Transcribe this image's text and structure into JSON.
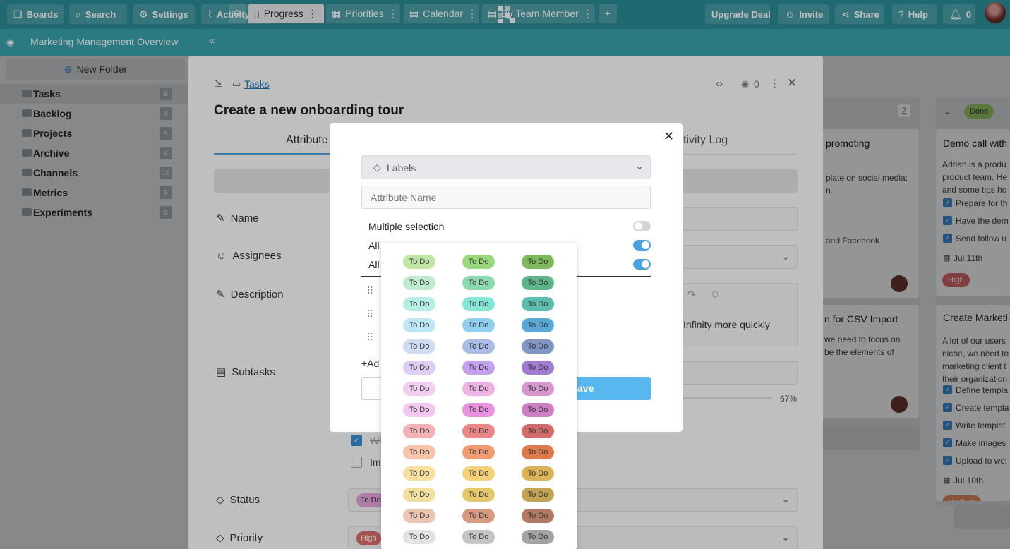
{
  "topbar": {
    "boards": "Boards",
    "search": "Search",
    "settings": "Settings",
    "activity_log": "Activity Log",
    "upgrade": "Upgrade Deal",
    "invite": "Invite",
    "share": "Share",
    "help": "Help",
    "notifications": "0"
  },
  "tabbar": {
    "board_title": "Marketing Management Overview",
    "tabs": [
      {
        "label": "Progress"
      },
      {
        "label": "Priorities"
      },
      {
        "label": "Calendar"
      },
      {
        "label": "By Team Member"
      }
    ],
    "add": "+"
  },
  "sidebar": {
    "new_folder": "New Folder",
    "folders": [
      {
        "label": "Tasks",
        "count": "8"
      },
      {
        "label": "Backlog",
        "count": "4"
      },
      {
        "label": "Projects",
        "count": "8"
      },
      {
        "label": "Archive",
        "count": "4"
      },
      {
        "label": "Channels",
        "count": "16"
      },
      {
        "label": "Metrics",
        "count": "9"
      },
      {
        "label": "Experiments",
        "count": "8"
      }
    ]
  },
  "board": {
    "col_count": "2",
    "done_badge": "Done",
    "cards": [
      {
        "title": "promoting",
        "line1": "plate on social media:",
        "line2": "n.",
        "line3": "and Facebook"
      },
      {
        "title": "n for CSV Import",
        "line1": "we need to focus on",
        "line2": "be the elements of"
      }
    ],
    "right_card1": {
      "title": "Demo call with",
      "body": [
        "Adrian is a produ",
        "product team. He",
        "and some tips ho"
      ],
      "checks": [
        "Prepare for th",
        "Have the dem",
        "Send follow u"
      ],
      "date": "Jul 11th",
      "priority": "High"
    },
    "right_card2": {
      "title": "Create Marketi",
      "body": [
        "A lot of our users",
        "niche, we need to",
        "marketing client t",
        "their organization"
      ],
      "checks": [
        "Define templa",
        "Create templa",
        "Write templat",
        "Make images",
        "Upload to wel"
      ],
      "date": "Jul 10th",
      "priority": "Medium"
    }
  },
  "task": {
    "breadcrumb": "Tasks",
    "watchers": "0",
    "title": "Create a new onboarding tour",
    "tab_attributes": "Attribute",
    "tab_activity": "ctivity Log",
    "labels": {
      "name": "Name",
      "assignees": "Assignees",
      "description": "Description",
      "subtasks": "Subtasks",
      "status": "Status",
      "priority": "Priority"
    },
    "description_text": "Infinity more quickly",
    "progress": "67%",
    "subtask1": "Wr",
    "subtask2": "Im",
    "status_value": "To Do",
    "priority_value": "High"
  },
  "modal": {
    "type_select": "Labels",
    "attr_name_placeholder": "Attribute Name",
    "multiple_selection": "Multiple selection",
    "allow1": "All",
    "allow2": "All",
    "add": "+Ad",
    "save": "ave"
  },
  "palette": {
    "chip_label": "To Do",
    "rows": [
      [
        "#bfe6a4",
        "#99d97b",
        "#7fb95e"
      ],
      [
        "#bfead0",
        "#8fd9ae",
        "#5fb48a"
      ],
      [
        "#b5efe4",
        "#86e6d6",
        "#5cbdb0"
      ],
      [
        "#bfe6f7",
        "#92d0ef",
        "#5aa9d8"
      ],
      [
        "#cfdcf2",
        "#a9bce5",
        "#7f95c4"
      ],
      [
        "#decdf2",
        "#c3a1ec",
        "#a07ccf"
      ],
      [
        "#f3cfee",
        "#eeb3e5",
        "#d697cf"
      ],
      [
        "#f3c8ef",
        "#e993e0",
        "#cc7fc2"
      ],
      [
        "#f3b3b4",
        "#ec8787",
        "#d26b6c"
      ],
      [
        "#f7c3a8",
        "#f29a70",
        "#dc7a4e"
      ],
      [
        "#f7e0a0",
        "#f5d27a",
        "#dcb457"
      ],
      [
        "#f1dfa0",
        "#e5c86c",
        "#c3a455"
      ],
      [
        "#ebc4b2",
        "#d69a80",
        "#b07a63"
      ],
      [
        "#e2e2e2",
        "#c4c4c4",
        "#a3a3a3"
      ]
    ]
  }
}
